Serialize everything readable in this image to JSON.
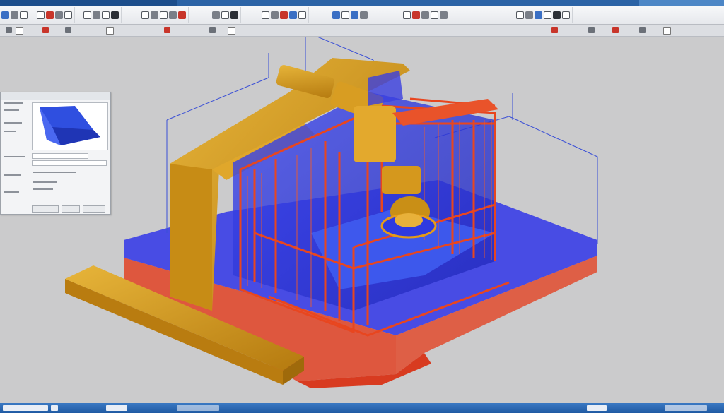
{
  "app": {
    "ribbon_groups": [
      "file-group",
      "edit-group",
      "view-group",
      "geometry-group",
      "mesh-group",
      "analysis-group",
      "display-group",
      "tools-group",
      "help-group"
    ]
  },
  "icons": {
    "accent": "#2b63a6",
    "model_orange": "#d29a1a",
    "model_red": "#e0401f",
    "model_blue": "#2f38e6"
  }
}
